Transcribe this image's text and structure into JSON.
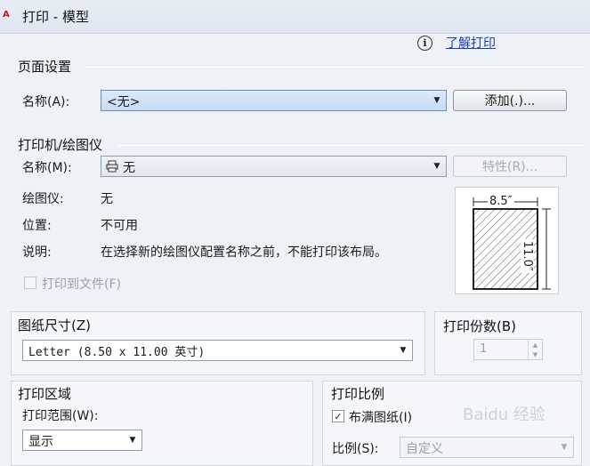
{
  "window": {
    "logo_text": "A",
    "title": "打印 - 模型"
  },
  "help": {
    "link_label": "了解打印"
  },
  "page_setup": {
    "group_title": "页面设置",
    "name_label": "名称(A):",
    "name_value": "<无>",
    "add_button_label": "添加(.)..."
  },
  "printer": {
    "group_title": "打印机/绘图仪",
    "name_label": "名称(M):",
    "name_value": "无",
    "properties_button_label": "特性(R)...",
    "plotter_label": "绘图仪:",
    "plotter_value": "无",
    "location_label": "位置:",
    "location_value": "不可用",
    "description_label": "说明:",
    "description_value": "在选择新的绘图仪配置名称之前，不能打印该布局。",
    "print_to_file_label": "打印到文件(F)",
    "preview_width_label": "8.5″",
    "preview_height_label": "11.0″"
  },
  "paper_size": {
    "group_title": "图纸尺寸(Z)",
    "value": "Letter (8.50 x 11.00 英寸)"
  },
  "copies": {
    "group_title": "打印份数(B)",
    "value": "1"
  },
  "plot_area": {
    "group_title": "打印区域",
    "range_label": "打印范围(W):",
    "range_value": "显示"
  },
  "plot_scale": {
    "group_title": "打印比例",
    "fit_to_paper_label": "布满图纸(I)",
    "fit_to_paper_checked": true,
    "scale_label": "比例(S):",
    "scale_value": "自定义"
  },
  "watermark": {
    "text": "Baidu 经验"
  }
}
